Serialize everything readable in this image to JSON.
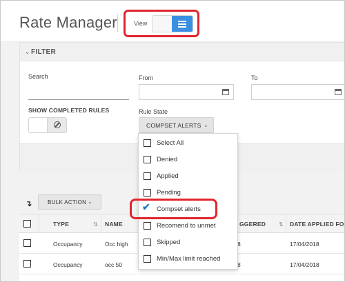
{
  "header": {
    "title": "Rate Manager",
    "view_label": "View",
    "view_icon": "list-icon",
    "accent_color": "#3b8fe0",
    "highlight_color": "#e0242b"
  },
  "filter": {
    "title": "FILTER",
    "search_label": "Search",
    "search_value": "",
    "from_label": "From",
    "from_value": "",
    "to_label": "To",
    "to_value": "",
    "show_completed_label": "SHOW COMPLETED RULES",
    "rule_state_label": "Rule State",
    "rule_state_value": "COMPSET ALERTS"
  },
  "rule_state_options": [
    {
      "label": "Select All",
      "checked": false
    },
    {
      "label": "Denied",
      "checked": false
    },
    {
      "label": "Applied",
      "checked": false
    },
    {
      "label": "Pending",
      "checked": false
    },
    {
      "label": "Compset alerts",
      "checked": true
    },
    {
      "label": "Recomend to unmet",
      "checked": false
    },
    {
      "label": "Skipped",
      "checked": false
    },
    {
      "label": "Min/Max limit reached",
      "checked": false
    }
  ],
  "toolbar": {
    "bulk_action_label": "BULK ACTION"
  },
  "table": {
    "columns": [
      "TYPE",
      "NAME",
      "GGERED",
      "DATE APPLIED FO"
    ],
    "rows": [
      {
        "type": "Occupancy",
        "name": "Occ high",
        "triggered": "8",
        "date_applied": "17/04/2018"
      },
      {
        "type": "Occupancy",
        "name": "occ 50",
        "triggered": "8",
        "date_applied": "17/04/2018"
      }
    ]
  }
}
